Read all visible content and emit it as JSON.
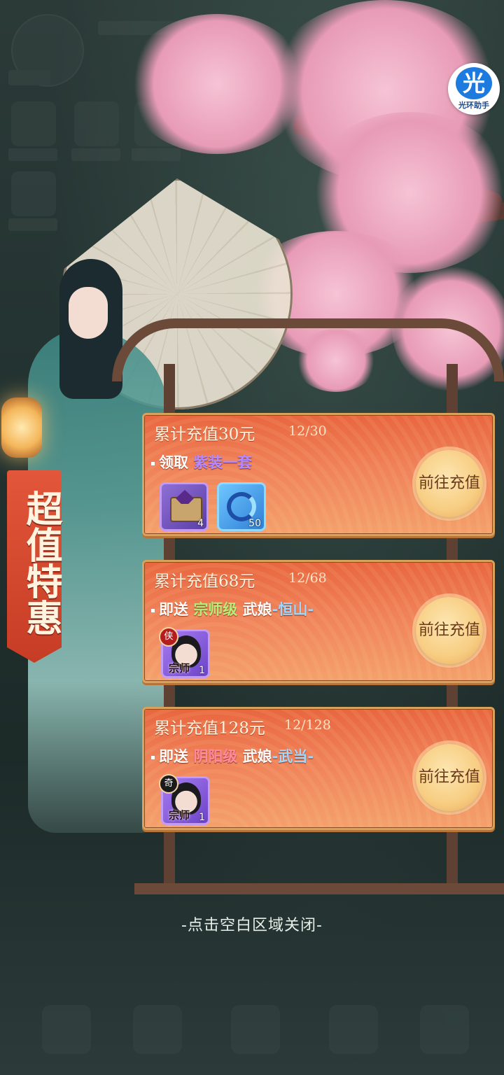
{
  "banner": {
    "text": "超值特惠"
  },
  "helper": {
    "icon": "光",
    "label": "光环助手"
  },
  "cards": [
    {
      "title": "累计充值30元",
      "progress": "12/30",
      "prefix": "领取",
      "rewards_text": [
        {
          "text": "紫装一套",
          "color": "purple"
        }
      ],
      "button": "前往充值",
      "items": [
        {
          "icon": "equipment-chest-icon",
          "qty": "4"
        },
        {
          "icon": "blue-swirl-orb-icon",
          "qty": "50"
        }
      ]
    },
    {
      "title": "累计充值68元",
      "progress": "12/68",
      "prefix": "即送",
      "grade": "宗师级",
      "hero_type": "武娘",
      "hero_name": "-恒山-",
      "button": "前往充值",
      "items": [
        {
          "icon": "hero-portrait-icon",
          "badge": "侠",
          "tag": "宗师",
          "qty": "1"
        }
      ]
    },
    {
      "title": "累计充值128元",
      "progress": "12/128",
      "prefix": "即送",
      "grade": "阴阳级",
      "hero_type": "武娘",
      "hero_name": "-武当-",
      "button": "前往充值",
      "items": [
        {
          "icon": "hero-portrait-icon",
          "badge": "奇",
          "tag": "宗师",
          "qty": "1"
        }
      ]
    }
  ],
  "close_hint": "-点击空白区域关闭-",
  "colors": {
    "card": "#ee7a52",
    "button": "#f7cd82",
    "highlight_purple": "#b48bff",
    "highlight_green": "#b5ef7a",
    "highlight_pink": "#ff8aa0"
  }
}
